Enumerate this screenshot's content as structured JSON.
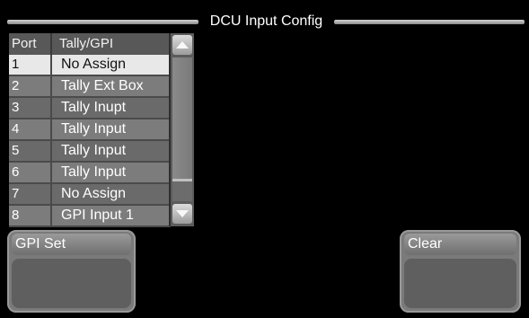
{
  "window": {
    "title": "DCU Input Config"
  },
  "table": {
    "columns": {
      "port": "Port",
      "tally": "Tally/GPI"
    },
    "rows": [
      {
        "port": "1",
        "value": "No Assign"
      },
      {
        "port": "2",
        "value": "Tally Ext Box"
      },
      {
        "port": "3",
        "value": "Tally Inupt"
      },
      {
        "port": "4",
        "value": "Tally Input"
      },
      {
        "port": "5",
        "value": "Tally Input"
      },
      {
        "port": "6",
        "value": "Tally Input"
      },
      {
        "port": "7",
        "value": "No Assign"
      },
      {
        "port": "8",
        "value": "GPI Input 1"
      }
    ],
    "selected_index": 0
  },
  "buttons": {
    "gpi_set": "GPI Set",
    "clear": "Clear"
  },
  "icons": {
    "scroll_up": "arrow-up-icon",
    "scroll_down": "arrow-down-icon"
  },
  "colors": {
    "background": "#000000",
    "panel": "#6e6e6e",
    "selected_row": "#e8e8e8"
  }
}
